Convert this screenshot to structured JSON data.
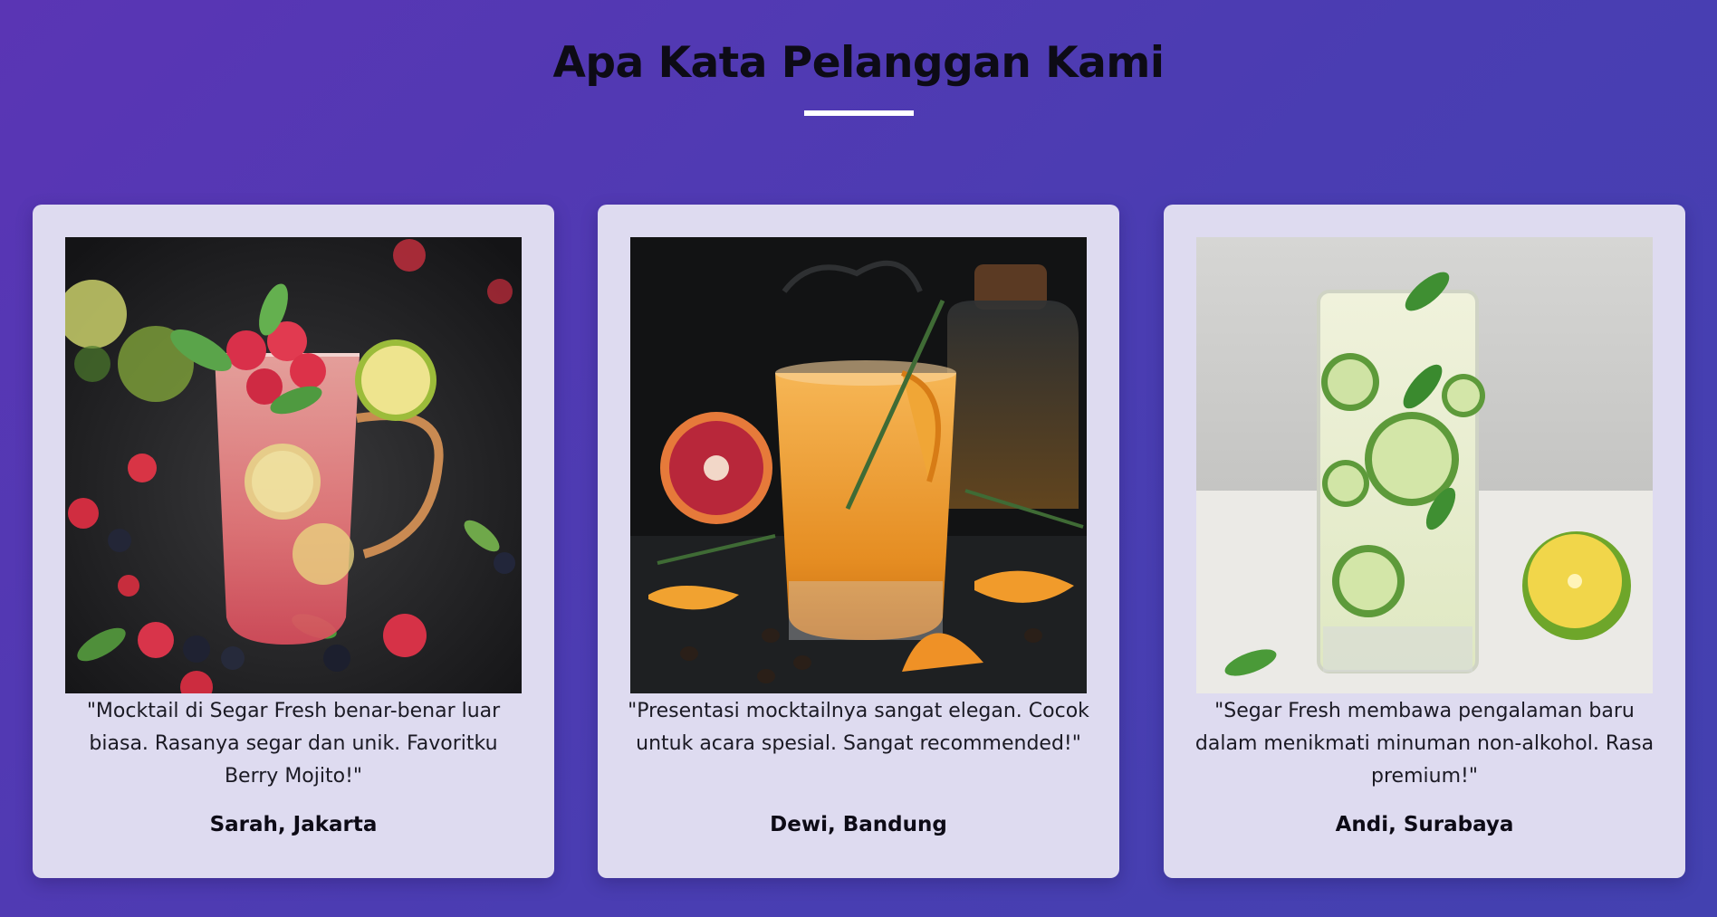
{
  "section": {
    "title": "Apa Kata Pelanggan Kami"
  },
  "testimonials": [
    {
      "quote": "\"Mocktail di Segar Fresh benar-benar luar biasa. Rasanya segar dan unik. Favoritku Berry Mojito!\"",
      "author": "Sarah, Jakarta",
      "image": "berry-mojito-photo"
    },
    {
      "quote": "\"Presentasi mocktailnya sangat elegan. Cocok untuk acara spesial. Sangat recommended!\"",
      "author": "Dewi, Bandung",
      "image": "orange-rosemary-drink-photo"
    },
    {
      "quote": "\"Segar Fresh membawa pengalaman baru dalam menikmati minuman non-alkohol. Rasa premium!\"",
      "author": "Andi, Surabaya",
      "image": "cucumber-lime-drink-photo"
    }
  ],
  "colors": {
    "background_start": "#5a35b4",
    "background_end": "#4341b0",
    "card_background": "#dedbf0",
    "title_text": "#0d0b16",
    "underline": "#ffffff"
  }
}
